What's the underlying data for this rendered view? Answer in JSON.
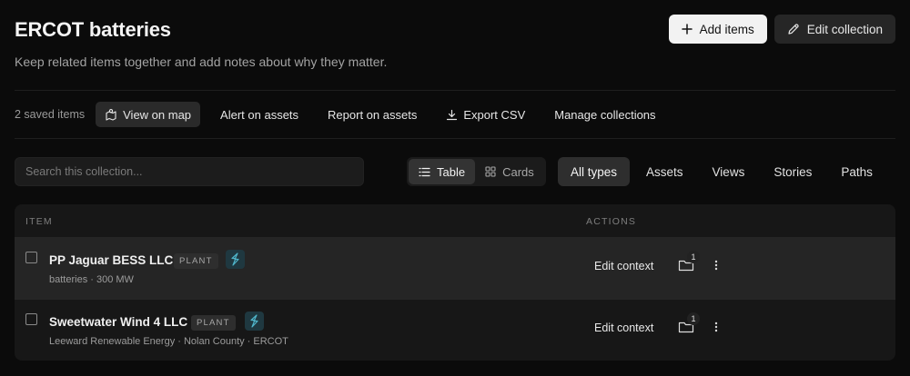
{
  "header": {
    "title": "ERCOT batteries",
    "subtitle": "Keep related items together and add notes about why they matter.",
    "add_items_label": "Add items",
    "edit_collection_label": "Edit collection"
  },
  "toolbar": {
    "saved_count": "2 saved items",
    "view_on_map": "View on map",
    "alert_on_assets": "Alert on assets",
    "report_on_assets": "Report on assets",
    "export_csv": "Export CSV",
    "manage_collections": "Manage collections"
  },
  "search": {
    "placeholder": "Search this collection..."
  },
  "view_toggle": {
    "table": "Table",
    "cards": "Cards",
    "selected": "Table"
  },
  "type_filters": [
    "All types",
    "Assets",
    "Views",
    "Stories",
    "Paths"
  ],
  "table": {
    "columns": {
      "item": "Item",
      "actions": "Actions"
    },
    "rows": [
      {
        "name": "PP Jaguar BESS LLC",
        "badge": "PLANT",
        "meta": "batteries · 300 MW",
        "edit_context": "Edit context",
        "folder_count": "1",
        "checked": false
      },
      {
        "name": "Sweetwater Wind 4 LLC",
        "badge": "PLANT",
        "meta": "Leeward Renewable Energy · Nolan County · ERCOT",
        "edit_context": "Edit context",
        "folder_count": "1",
        "checked": false
      }
    ]
  },
  "icons": {
    "add": "plus-icon",
    "edit": "pencil-icon",
    "map": "map-pin-icon",
    "export": "download-icon",
    "table": "list-icon",
    "cards": "grid-icon",
    "bolt": "bolt-icon",
    "folder": "folder-icon",
    "more": "more-vertical-icon"
  },
  "colors": {
    "background": "#0b0b0b",
    "panel": "#171717",
    "bolt_accent": "#4fb3c8"
  }
}
